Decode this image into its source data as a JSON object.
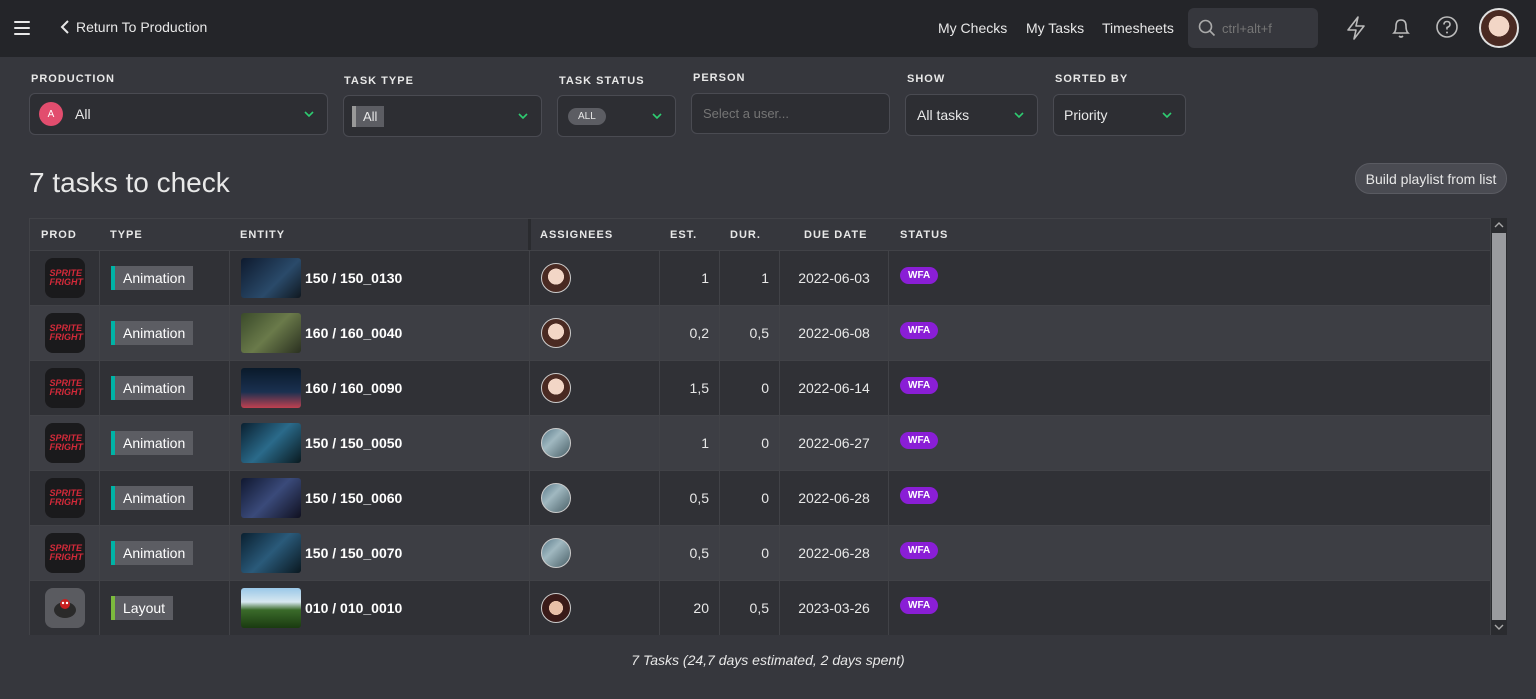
{
  "topbar": {
    "back_label": "Return To Production",
    "nav": [
      "My Checks",
      "My Tasks",
      "Timesheets"
    ],
    "search_placeholder": "ctrl+alt+f"
  },
  "filters": {
    "production": {
      "label": "PRODUCTION",
      "initial": "A",
      "value": "All"
    },
    "task_type": {
      "label": "TASK TYPE",
      "value": "All"
    },
    "task_status": {
      "label": "TASK STATUS",
      "value": "ALL"
    },
    "person": {
      "label": "PERSON",
      "placeholder": "Select a user..."
    },
    "show": {
      "label": "SHOW",
      "value": "All tasks"
    },
    "sorted_by": {
      "label": "SORTED BY",
      "value": "Priority"
    }
  },
  "heading": "7 tasks to check",
  "playlist_button": "Build playlist from list",
  "table": {
    "headers": [
      "PROD",
      "TYPE",
      "ENTITY",
      "ASSIGNEES",
      "EST.",
      "DUR.",
      "DUE DATE",
      "STATUS"
    ],
    "rows": [
      {
        "prod": "SPRITE FRIGHT",
        "type": "Animation",
        "entity": "150 / 150_0130",
        "assignee": "user-a",
        "est": "1",
        "dur": "1",
        "due": "2022-06-03",
        "status": "WFA"
      },
      {
        "prod": "SPRITE FRIGHT",
        "type": "Animation",
        "entity": "160 / 160_0040",
        "assignee": "user-a",
        "est": "0,2",
        "dur": "0,5",
        "due": "2022-06-08",
        "status": "WFA"
      },
      {
        "prod": "SPRITE FRIGHT",
        "type": "Animation",
        "entity": "160 / 160_0090",
        "assignee": "user-a",
        "est": "1,5",
        "dur": "0",
        "due": "2022-06-14",
        "status": "WFA"
      },
      {
        "prod": "SPRITE FRIGHT",
        "type": "Animation",
        "entity": "150 / 150_0050",
        "assignee": "user-b",
        "est": "1",
        "dur": "0",
        "due": "2022-06-27",
        "status": "WFA"
      },
      {
        "prod": "SPRITE FRIGHT",
        "type": "Animation",
        "entity": "150 / 150_0060",
        "assignee": "user-b",
        "est": "0,5",
        "dur": "0",
        "due": "2022-06-28",
        "status": "WFA"
      },
      {
        "prod": "SPRITE FRIGHT",
        "type": "Animation",
        "entity": "150 / 150_0070",
        "assignee": "user-b",
        "est": "0,5",
        "dur": "0",
        "due": "2022-06-28",
        "status": "WFA"
      },
      {
        "prod": "",
        "type": "Layout",
        "entity": "010 / 010_0010",
        "assignee": "user-c",
        "est": "20",
        "dur": "0,5",
        "due": "2023-03-26",
        "status": "WFA"
      }
    ]
  },
  "footer": "7 Tasks (24,7 days estimated, 2 days spent)",
  "colors": {
    "status_wfa": "#8a1ed6",
    "animation": "#00b3a6",
    "layout": "#7cba3d",
    "production_dot": "#e24d6e"
  }
}
